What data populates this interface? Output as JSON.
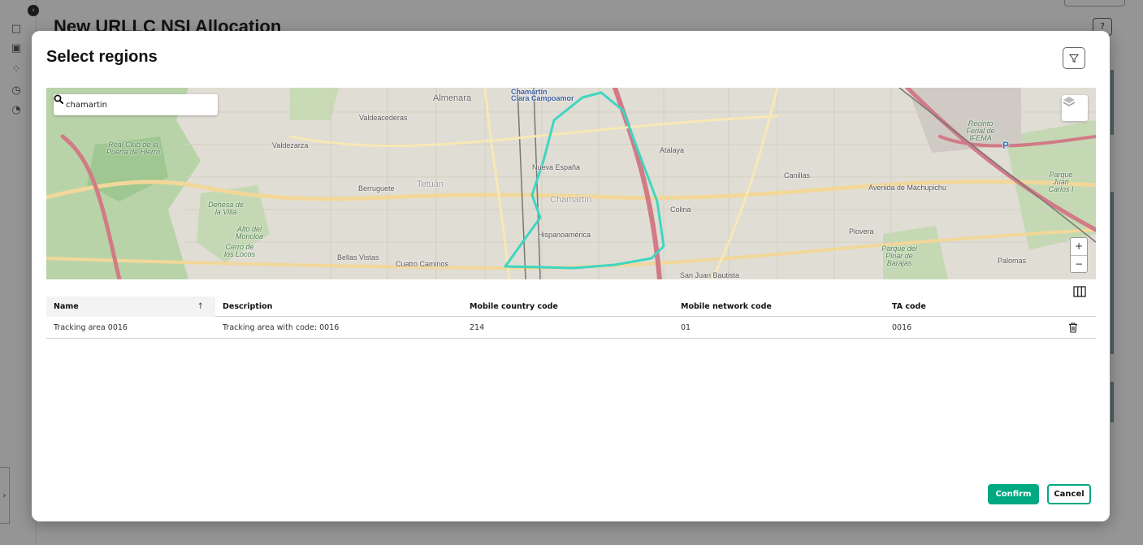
{
  "app": {
    "page_title": "New URLLC NSI Allocation",
    "help_icon": "help-icon",
    "sidebar_icons": [
      "map-icon",
      "dashboard-icon",
      "network-icon",
      "clock-icon",
      "pie-chart-icon"
    ]
  },
  "modal": {
    "title": "Select regions",
    "filter_icon": "filter-icon"
  },
  "map": {
    "search": {
      "value": "chamartin",
      "icon": "search-icon"
    },
    "layers_icon": "layers-icon",
    "zoom_in": "+",
    "zoom_out": "−",
    "labels": [
      "Almenara",
      "Chamartín",
      "Ciara Campoamor",
      "Valdeacederas",
      "Valdezarza",
      "Real Club de la Puerta de Hierro",
      "Berruguete",
      "Tetuán",
      "Nueva España",
      "Chamartín",
      "Atalaya",
      "Colina",
      "Canillas",
      "Avenida de Machupichu",
      "Recinto Ferial de IFEMA",
      "Parque Juan Carlos I",
      "Hispanoamérica",
      "Piovera",
      "Parque del Pinar de Barajas",
      "Palomas",
      "Bellas Vistas",
      "Cuatro Caminos",
      "San Juan Bautista",
      "Cerro de los Locos",
      "Dehesa de la Villa",
      "Alto del Moncloa",
      "P"
    ]
  },
  "table": {
    "columns_icon": "columns-icon",
    "headers": [
      "Name",
      "Description",
      "Mobile country code",
      "Mobile network code",
      "TA code"
    ],
    "sort_indicator": "↑",
    "rows": [
      {
        "name": "Tracking area 0016",
        "description": "Tracking area with code: 0016",
        "mcc": "214",
        "mnc": "01",
        "ta_code": "0016",
        "action_icon": "trash-icon"
      }
    ]
  },
  "footer": {
    "confirm": "Confirm",
    "cancel": "Cancel"
  },
  "colors": {
    "accent": "#01a982",
    "region_outline": "#3ed6c2"
  }
}
